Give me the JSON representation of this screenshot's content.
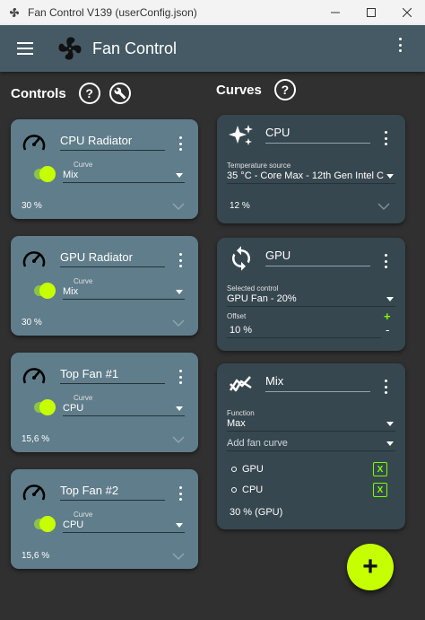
{
  "window": {
    "title": "Fan Control V139 (userConfig.json)"
  },
  "appbar": {
    "title": "Fan Control"
  },
  "controls_section": {
    "label": "Controls",
    "help_glyph": "?"
  },
  "curves_section": {
    "label": "Curves",
    "help_glyph": "?"
  },
  "controls": [
    {
      "name": "CPU Radiator",
      "curve_label": "Curve",
      "curve": "Mix",
      "percent": "30 %"
    },
    {
      "name": "GPU Radiator",
      "curve_label": "Curve",
      "curve": "Mix",
      "percent": "30 %"
    },
    {
      "name": "Top Fan #1",
      "curve_label": "Curve",
      "curve": "CPU",
      "percent": "15,6 %"
    },
    {
      "name": "Top Fan #2",
      "curve_label": "Curve",
      "curve": "CPU",
      "percent": "15,6 %"
    }
  ],
  "curves": {
    "cpu": {
      "name": "CPU",
      "source_label": "Temperature source",
      "source": "35 °C - Core Max - 12th Gen Intel C",
      "percent": "12 %"
    },
    "gpu": {
      "name": "GPU",
      "control_label": "Selected control",
      "control": "GPU Fan - 20%",
      "offset_label": "Offset",
      "offset": "10 %",
      "plus": "+",
      "minus": "-"
    },
    "mix": {
      "name": "Mix",
      "function_label": "Function",
      "function": "Max",
      "add_placeholder": "Add fan curve",
      "members": [
        {
          "name": "GPU",
          "remove": "X"
        },
        {
          "name": "CPU",
          "remove": "X"
        }
      ],
      "result": "30 % (GPU)"
    }
  },
  "fab": {
    "glyph": "+"
  },
  "colors": {
    "appbar": "#455a64",
    "control_card": "#607d8b",
    "curve_card": "#37474f",
    "accent": "#c6ff00",
    "background": "#303030"
  },
  "icons": {
    "app": "fan-icon",
    "menu": "hamburger-icon",
    "settings": "wrench-icon",
    "control": "gauge-icon",
    "cpu_curve": "sparkle-icon",
    "gpu_curve": "sync-icon",
    "mix_curve": "mix-chart-icon"
  }
}
